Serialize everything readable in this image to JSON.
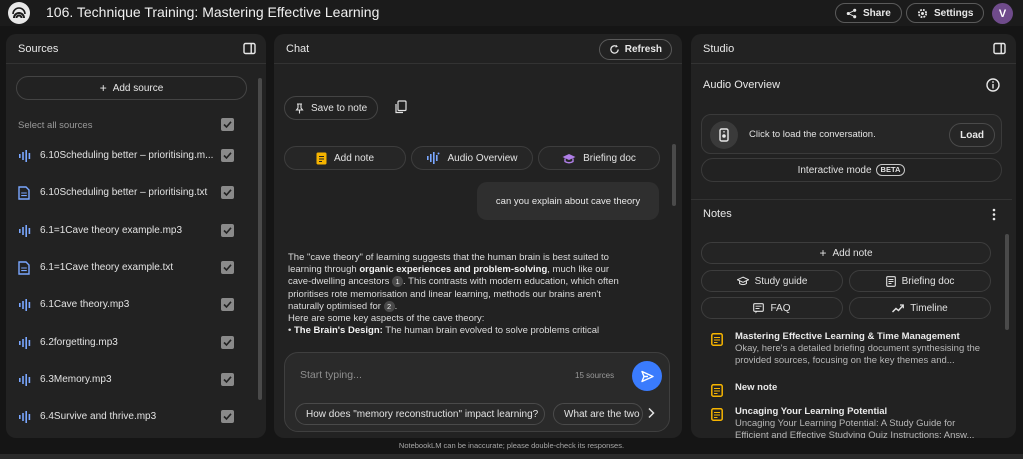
{
  "app": {
    "title": "106. Technique Training: Mastering Effective Learning",
    "share_label": "Share",
    "settings_label": "Settings",
    "avatar_initial": "V"
  },
  "sources": {
    "title": "Sources",
    "add_label": "Add source",
    "select_all_label": "Select all sources",
    "items": [
      {
        "label": "6.10Scheduling better – prioritising.m...",
        "icon": "audio-icon",
        "checked": true
      },
      {
        "label": "6.10Scheduling better – prioritising.txt",
        "icon": "document-icon",
        "checked": true
      },
      {
        "label": "6.1=1Cave theory example.mp3",
        "icon": "audio-icon",
        "checked": true
      },
      {
        "label": "6.1=1Cave theory example.txt",
        "icon": "document-icon",
        "checked": true
      },
      {
        "label": "6.1Cave theory.mp3",
        "icon": "audio-icon",
        "checked": true
      },
      {
        "label": "6.2forgetting.mp3",
        "icon": "audio-icon",
        "checked": true
      },
      {
        "label": "6.3Memory.mp3",
        "icon": "audio-icon",
        "checked": true
      },
      {
        "label": "6.4Survive and thrive.mp3",
        "icon": "audio-icon",
        "checked": true
      }
    ]
  },
  "chat": {
    "title": "Chat",
    "refresh_label": "Refresh",
    "save_note_label": "Save to note",
    "actions": [
      {
        "label": "Add note",
        "icon": "note-icon"
      },
      {
        "label": "Audio Overview",
        "icon": "waveform-icon"
      },
      {
        "label": "Briefing doc",
        "icon": "graduation-cap-icon"
      }
    ],
    "user_message": "can you explain about cave theory",
    "answer": {
      "p1_a": "The \"cave theory\" of learning suggests that the human brain is best suited to learning through ",
      "p1_b": "organic experiences and problem-solving",
      "p1_c": ", much like our cave-dwelling ancestors ",
      "cite1": "1",
      "p1_d": ". This contrasts with modern education, which often prioritises rote memorisation and linear learning, methods our brains aren't naturally optimised for ",
      "cite2": "2",
      "p1_e": ".",
      "p2": "Here are some key aspects of the cave theory:",
      "bullet_bold": "The Brain's Design:",
      "bullet_text": " The human brain evolved to solve problems critical"
    },
    "input_placeholder": "Start typing...",
    "source_count": "15 sources",
    "suggestions": [
      "How does \"memory reconstruction\" impact learning?",
      "What are the two"
    ]
  },
  "studio": {
    "title": "Studio",
    "audio_overview_title": "Audio Overview",
    "load_text": "Click to load the conversation.",
    "load_label": "Load",
    "interactive_label": "Interactive mode",
    "beta_label": "BETA",
    "notes_title": "Notes",
    "add_note_label": "Add note",
    "note_buttons": [
      {
        "label": "Study guide",
        "icon": "graduation-cap-icon"
      },
      {
        "label": "Briefing doc",
        "icon": "document-icon"
      },
      {
        "label": "FAQ",
        "icon": "chat-icon"
      },
      {
        "label": "Timeline",
        "icon": "trend-icon"
      }
    ],
    "notes": [
      {
        "title": "Mastering Effective Learning & Time Management",
        "body": "Okay, here's a detailed briefing document synthesising the provided sources, focusing on the key themes and..."
      },
      {
        "title": "New note",
        "body": ""
      },
      {
        "title": "Uncaging Your Learning Potential",
        "body": "Uncaging Your Learning Potential: A Study Guide for Efficient and Effective Studying Quiz Instructions: Answ..."
      }
    ]
  },
  "footer": "NotebookLM can be inaccurate; please double-check its responses.",
  "colors": {
    "accent": "#3a7bfd",
    "note_icon": "#f6b400",
    "audio_icon": "#7aa7ff",
    "doc_icon": "#7aa7ff"
  }
}
